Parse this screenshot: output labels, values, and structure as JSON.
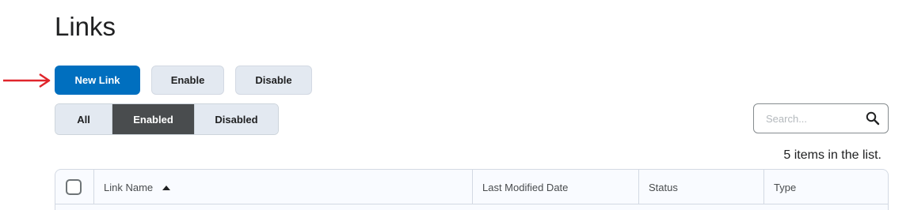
{
  "page": {
    "title": "Links"
  },
  "toolbar": {
    "new_link_label": "New Link",
    "enable_label": "Enable",
    "disable_label": "Disable"
  },
  "filters": {
    "items": [
      {
        "label": "All",
        "active": false
      },
      {
        "label": "Enabled",
        "active": true
      },
      {
        "label": "Disabled",
        "active": false
      }
    ]
  },
  "search": {
    "placeholder": "Search...",
    "value": ""
  },
  "list": {
    "count_text": "5 items in the list."
  },
  "table": {
    "columns": [
      {
        "label": "Link Name",
        "sort": "ascending"
      },
      {
        "label": "Last Modified Date"
      },
      {
        "label": "Status"
      },
      {
        "label": "Type"
      }
    ]
  },
  "annotation": {
    "arrow_color": "#e0252b"
  },
  "colors": {
    "primary": "#006fbf",
    "active_filter": "#494c4e"
  }
}
